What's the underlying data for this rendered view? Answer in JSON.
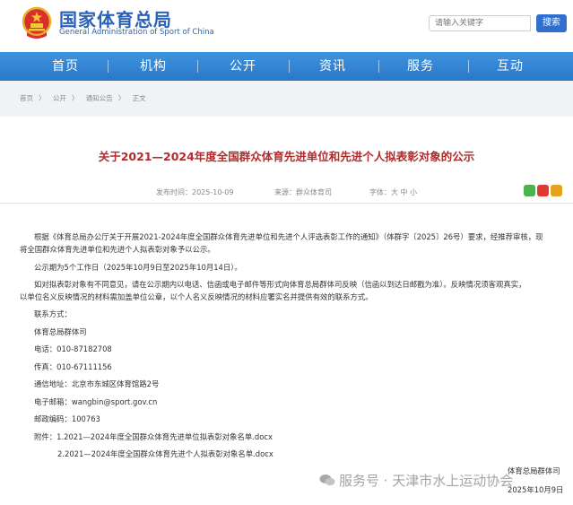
{
  "header": {
    "brand_cn": "国家体育总局",
    "brand_en": "General Administration of Sport of China",
    "search_placeholder": "请输入关键字",
    "search_button": "搜索"
  },
  "nav": {
    "items": [
      "首页",
      "机构",
      "公开",
      "资讯",
      "服务",
      "互动"
    ]
  },
  "breadcrumb": [
    "首页",
    "公开",
    "通知公告",
    "正文"
  ],
  "article": {
    "title": "关于2021—2024年度全国群众体育先进单位和先进个人拟表彰对象的公示",
    "published": "发布时间：2025-10-09",
    "source": "来源：群众体育司",
    "font_size": "字体：大 中 小",
    "paragraphs": [
      "根据《体育总局办公厅关于开展2021-2024年度全国群众体育先进单位和先进个人评选表彰工作的通知》（体群字〔2025〕26号）要求，经推荐审核，现",
      "将全国群众体育先进单位和先进个人拟表彰对象予以公示。",
      "公示期为5个工作日（2025年10月9日至2025年10月14日）。",
      "如对拟表彰对象有不同意见，请在公示期内以电话、信函或电子邮件等形式向体育总局群体司反映（信函以到达日邮戳为准）。反映情况须客观真实，",
      "以单位名义反映情况的材料需加盖单位公章，以个人名义反映情况的材料应署实名并提供有效的联系方式。",
      "联系方式：",
      "体育总局群体司",
      "电话：010-87182708",
      "传真：010-67111156",
      "通信地址：北京市东城区体育馆路2号",
      "电子邮箱：wangbin@sport.gov.cn",
      "邮政编码：100763",
      "附件：1.2021—2024年度全国群众体育先进单位拟表彰对象名单.docx",
      "2.2021—2024年度全国群众体育先进个人拟表彰对象名单.docx"
    ],
    "footer_org": "体育总局群体司",
    "footer_date": "2025年10月9日"
  },
  "watermark": "服务号 · 天津市水上运动协会",
  "colors": {
    "brand_blue": "#2a62b8",
    "nav_blue": "#3487d6",
    "title_red": "#b22a2a"
  }
}
